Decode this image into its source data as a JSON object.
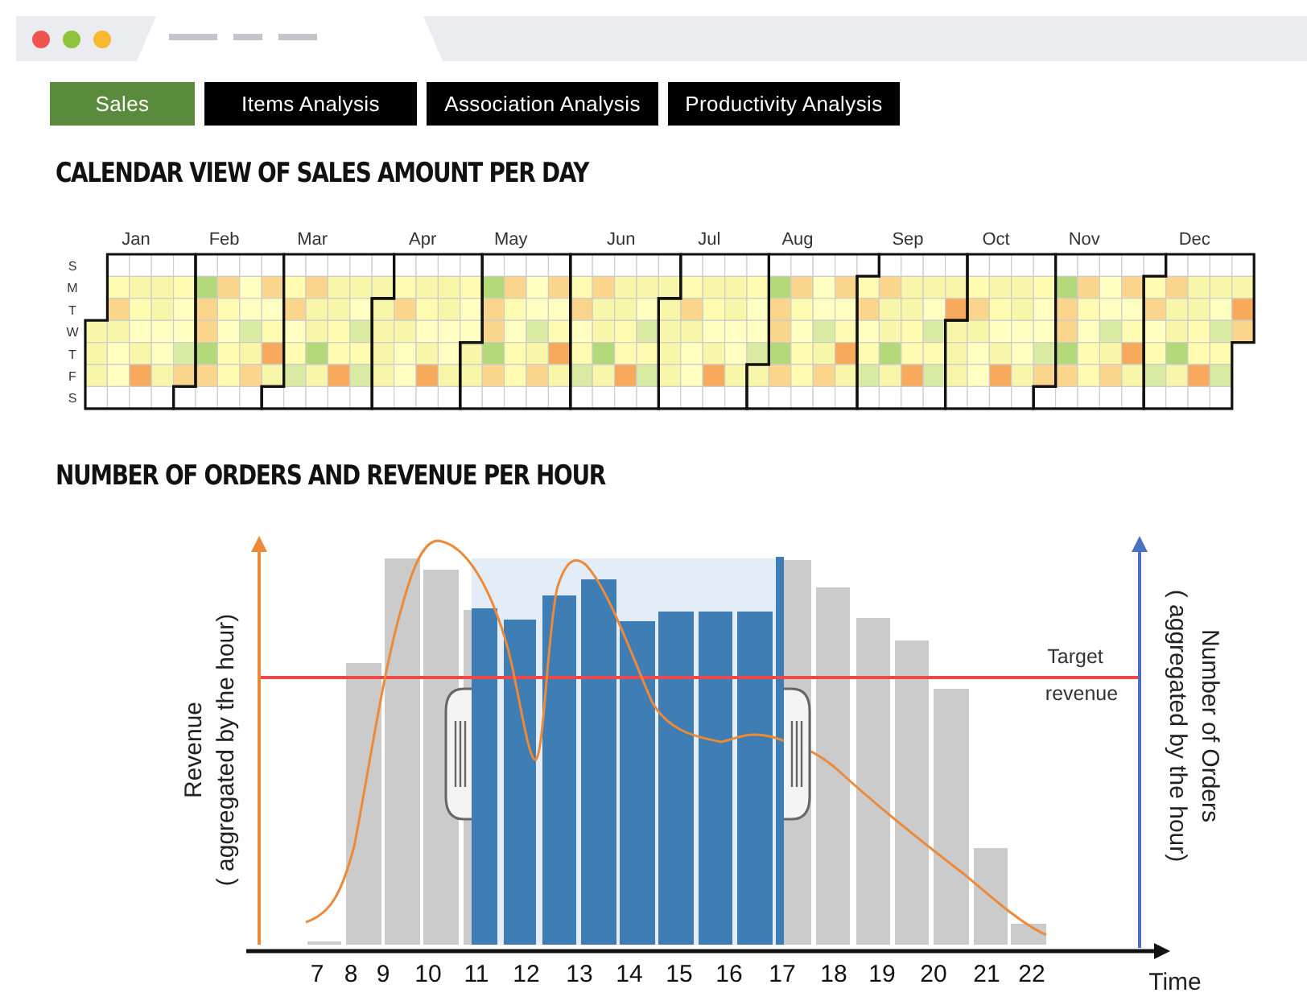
{
  "tabs": [
    {
      "label": "Sales",
      "selected": true
    },
    {
      "label": "Items Analysis",
      "selected": false
    },
    {
      "label": "Association Analysis",
      "selected": false
    },
    {
      "label": "Productivity Analysis",
      "selected": false
    }
  ],
  "calendar": {
    "title": "CALENDAR VIEW OF SALES AMOUNT PER DAY",
    "months": [
      "Jan",
      "Feb",
      "Mar",
      "Apr",
      "May",
      "Jun",
      "Jul",
      "Aug",
      "Sep",
      "Oct",
      "Nov",
      "Dec"
    ],
    "days": [
      "S",
      "M",
      "T",
      "W",
      "T",
      "F",
      "S"
    ]
  },
  "chart": {
    "title": "NUMBER OF ORDERS AND REVENUE PER HOUR",
    "left_axis_label": [
      "Revenue",
      "( aggregated by the hour)"
    ],
    "right_axis_label": [
      "Number of Orders",
      "( aggregated by the hour)"
    ],
    "target_label": [
      "Target",
      "revenue"
    ],
    "hours": [
      "7",
      "8",
      "9",
      "10",
      "11",
      "12",
      "13",
      "14",
      "15",
      "16",
      "17",
      "18",
      "19",
      "20",
      "21",
      "22"
    ],
    "x_label": "Time"
  }
}
